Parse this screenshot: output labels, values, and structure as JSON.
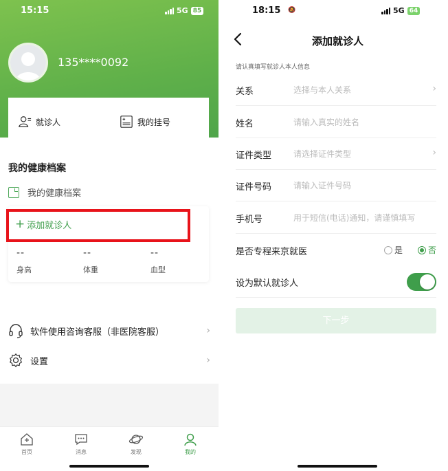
{
  "left": {
    "status": {
      "time": "15:15",
      "network": "5G",
      "battery": "85"
    },
    "profile": {
      "phone_masked": "135****0092"
    },
    "quick_actions": [
      {
        "label": "就诊人",
        "icon": "patient-card-icon"
      },
      {
        "label": "我的挂号",
        "icon": "registration-list-icon"
      }
    ],
    "health": {
      "section_title": "我的健康档案",
      "archive_label": "我的健康档案",
      "add_patient": "添加就诊人",
      "metrics": [
        {
          "value": "--",
          "label": "身高"
        },
        {
          "value": "--",
          "label": "体重"
        },
        {
          "value": "--",
          "label": "血型"
        }
      ]
    },
    "menu": [
      {
        "label": "软件使用咨询客服（非医院客服）",
        "icon": "headset-icon"
      },
      {
        "label": "设置",
        "icon": "gear-icon"
      }
    ],
    "tabs": [
      {
        "label": "首页",
        "icon": "home-icon"
      },
      {
        "label": "消息",
        "icon": "message-icon"
      },
      {
        "label": "发现",
        "icon": "planet-icon"
      },
      {
        "label": "我的",
        "icon": "user-icon",
        "active": true
      }
    ]
  },
  "right": {
    "status": {
      "time": "18:15",
      "network": "5G",
      "battery": "64"
    },
    "title": "添加就诊人",
    "hint": "请认真填写就诊人本人信息",
    "fields": [
      {
        "label": "关系",
        "placeholder": "选择与本人关系",
        "has_chevron": true
      },
      {
        "label": "姓名",
        "placeholder": "请输入真实的姓名"
      },
      {
        "label": "证件类型",
        "placeholder": "请选择证件类型",
        "has_chevron": true
      },
      {
        "label": "证件号码",
        "placeholder": "请输入证件号码"
      },
      {
        "label": "手机号",
        "placeholder": "用于短信(电话)通知，请谨慎填写"
      }
    ],
    "beijing_question": {
      "label": "是否专程来京就医",
      "yes": "是",
      "no": "否",
      "selected": "否"
    },
    "default_toggle": {
      "label": "设为默认就诊人",
      "on": true
    },
    "next_button": "下一步"
  },
  "colors": {
    "primary": "#3f9e4b",
    "header_green": "#5fb04a",
    "highlight_red": "#e8131a"
  }
}
